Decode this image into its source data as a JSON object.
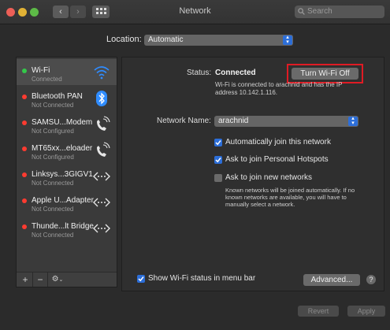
{
  "window": {
    "title": "Network"
  },
  "toolbar": {
    "search_placeholder": "Search"
  },
  "location": {
    "label": "Location:",
    "value": "Automatic"
  },
  "services": [
    {
      "name": "Wi-Fi",
      "status": "Connected",
      "dot": "#34c84a",
      "icon": "wifi-icon"
    },
    {
      "name": "Bluetooth PAN",
      "status": "Not Connected",
      "dot": "#ff3b30",
      "icon": "bluetooth-icon"
    },
    {
      "name": "SAMSU...Modem",
      "status": "Not Configured",
      "dot": "#ff3b30",
      "icon": "phone-icon"
    },
    {
      "name": "MT65xx...eloader",
      "status": "Not Configured",
      "dot": "#ff3b30",
      "icon": "phone-icon"
    },
    {
      "name": "Linksys...3GIGV1",
      "status": "Not Connected",
      "dot": "#ff3b30",
      "icon": "ethernet-icon"
    },
    {
      "name": "Apple U...Adapter",
      "status": "Not Connected",
      "dot": "#ff3b30",
      "icon": "ethernet-icon"
    },
    {
      "name": "Thunde...lt Bridge",
      "status": "Not Connected",
      "dot": "#ff3b30",
      "icon": "ethernet-icon"
    }
  ],
  "sidebar_controls": {
    "add": "+",
    "remove": "−",
    "gear": "⚙"
  },
  "status": {
    "label": "Status:",
    "value": "Connected",
    "button": "Turn Wi-Fi Off",
    "info": "Wi-Fi is connected to arachnid and has the IP address 10.142.1.116."
  },
  "network_name": {
    "label": "Network Name:",
    "value": "arachnid"
  },
  "options": {
    "auto_join": "Automatically join this network",
    "hotspots": "Ask to join Personal Hotspots",
    "new_networks": "Ask to join new networks"
  },
  "note": "Known networks will be joined automatically. If no known networks are available, you will have to manually select a network.",
  "show_status": "Show Wi-Fi status in menu bar",
  "advanced": "Advanced...",
  "help": "?",
  "footer": {
    "revert": "Revert",
    "apply": "Apply"
  },
  "colors": {
    "accent": "#2c6ed8",
    "highlight_box": "#e01b24"
  }
}
